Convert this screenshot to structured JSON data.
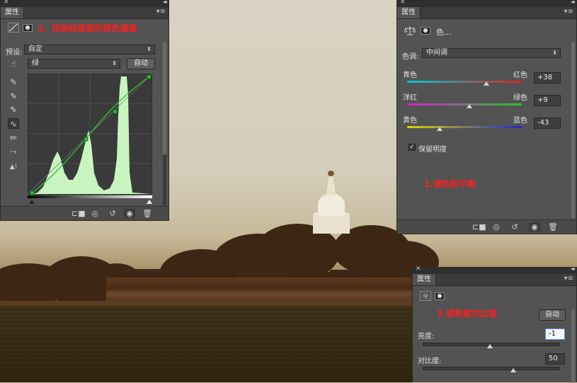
{
  "curves_panel": {
    "tab_label": "属性",
    "annotation": "2、控曲线里面的绿色通道",
    "preset_label": "预设:",
    "preset_value": "自定",
    "channel_value": "绿",
    "auto_label": "自动"
  },
  "color_balance_panel": {
    "tab_label": "属性",
    "title": "色...",
    "tone_label": "色调:",
    "tone_value": "中间调",
    "sliders": [
      {
        "left": "青色",
        "right": "红色",
        "value": "+38",
        "level": 38
      },
      {
        "left": "洋红",
        "right": "绿色",
        "value": "+9",
        "level": 9
      },
      {
        "left": "黄色",
        "right": "蓝色",
        "value": "-43",
        "level": -43
      }
    ],
    "preserve_label": "保留明度",
    "preserve_checked": true,
    "annotation": "1.调色彩平衡"
  },
  "brightness_panel": {
    "tab_label": "属性",
    "annotation": "3.调亮度对比度",
    "auto_label": "自动",
    "brightness_label": "亮度:",
    "brightness_value": "-1",
    "brightness_level": -1,
    "contrast_label": "对比度:",
    "contrast_value": "50",
    "contrast_level": 50
  },
  "colors": {
    "annotation_red": "#ff1e1e",
    "panel_bg": "#535353",
    "histogram": "#c8f5bf",
    "curve": "#2ec436"
  },
  "icons": [
    "close-icon",
    "collapse-icon",
    "panel-menu-icon",
    "curves-icon",
    "mask-icon",
    "hand-target-icon",
    "eyedropper-icon",
    "curve-point-icon",
    "pencil-icon",
    "smooth-icon",
    "clipping-warning-icon",
    "balance-scale-icon",
    "sun-icon",
    "clip-to-layer-icon",
    "view-previous-icon",
    "reset-icon",
    "visibility-eye-icon",
    "trash-icon"
  ]
}
